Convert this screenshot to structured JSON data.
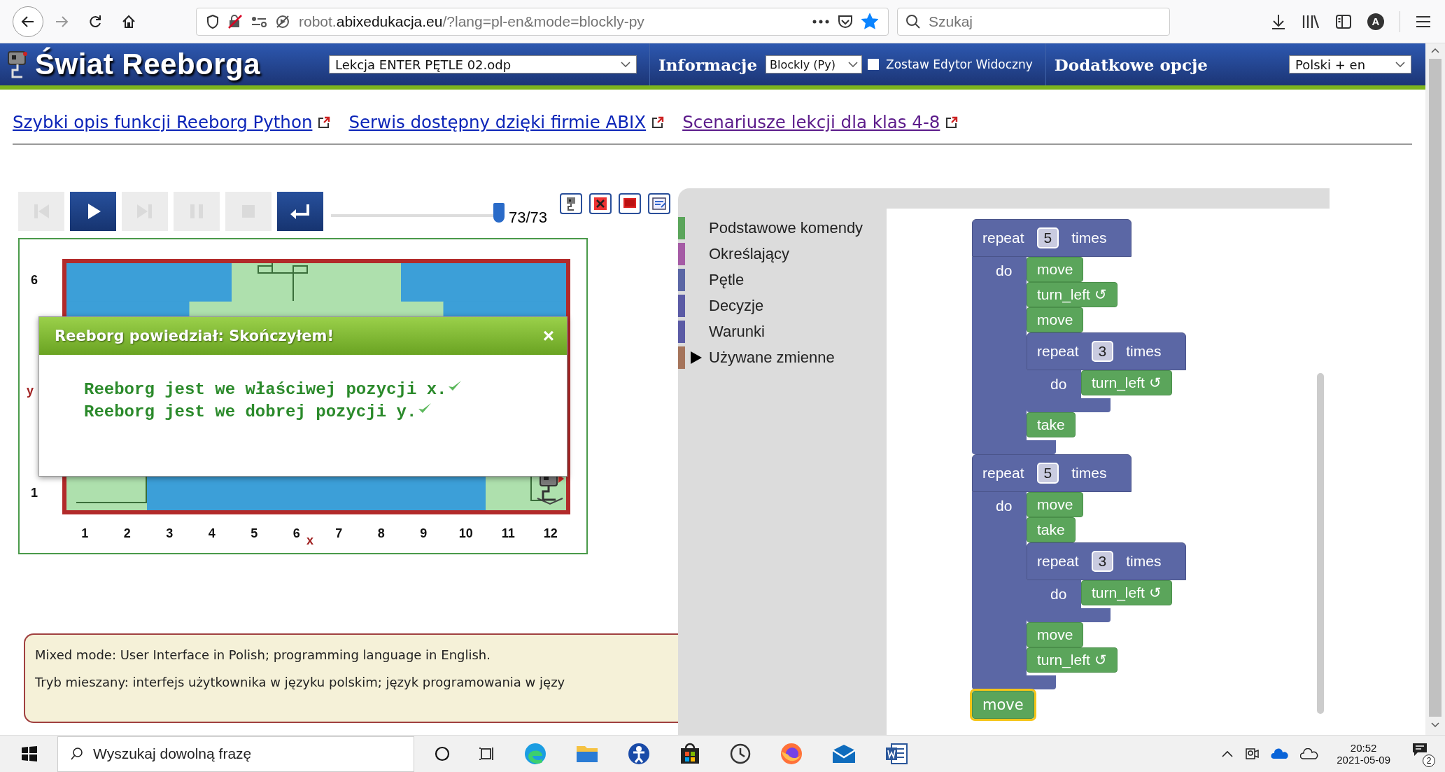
{
  "browser": {
    "nav_buttons": [
      {
        "kind": "back",
        "disabled": false
      },
      {
        "kind": "forward",
        "disabled": true
      },
      {
        "kind": "reload",
        "disabled": false
      },
      {
        "kind": "home",
        "disabled": false
      }
    ],
    "url": {
      "host_prefix": "robot.",
      "domain": "abixedukacja.eu",
      "path": "/?lang=pl-en&mode=blockly-py"
    },
    "bookmarked": true,
    "search": {
      "placeholder": "Szukaj"
    },
    "account_initial": "A"
  },
  "site_header": {
    "title": "Świat Reeborga",
    "lesson_select": "Lekcja ENTER PĘTLE 02.odp",
    "info_menu": "Informacje",
    "mode_select": "Blockly (Py)",
    "keep_editor": {
      "label": "Zostaw Edytor Widoczny",
      "checked": false
    },
    "more_options": "Dodatkowe opcje",
    "language_select": "Polski + en"
  },
  "links": [
    {
      "text": "Szybki opis funkcji Reeborg Python",
      "visited": false
    },
    {
      "text": "Serwis dostępny dzięki firmie ABIX",
      "visited": false
    },
    {
      "text": "Scenariusze lekcji dla klas 4-8",
      "visited": true
    }
  ],
  "controls": {
    "buttons": [
      {
        "kind": "first",
        "disabled": true
      },
      {
        "kind": "play",
        "disabled": false
      },
      {
        "kind": "step",
        "disabled": true
      },
      {
        "kind": "pause",
        "disabled": true
      },
      {
        "kind": "stop",
        "disabled": true
      },
      {
        "kind": "return",
        "disabled": false
      }
    ],
    "slider": {
      "level": 1
    },
    "step_counter": "73/73",
    "tools": [
      {
        "kind": "robot"
      },
      {
        "kind": "remove"
      },
      {
        "kind": "flag"
      },
      {
        "kind": "edit"
      }
    ]
  },
  "world": {
    "y_axis_label": "y",
    "x_axis_label": "x",
    "y_labels": [
      "6",
      "1"
    ],
    "x_labels": [
      "1",
      "2",
      "3",
      "4",
      "5",
      "6",
      "7",
      "8",
      "9",
      "10",
      "11",
      "12"
    ]
  },
  "message": {
    "title": "Reeborg powiedział: Skończyłem!",
    "close": "×",
    "lines": [
      {
        "text": "Reeborg jest we właściwej pozycji x.",
        "passed": true
      },
      {
        "text": "Reeborg jest we dobrej pozycji y.",
        "passed": true
      }
    ]
  },
  "info": {
    "lines": [
      "Mixed mode: User Interface in Polish; programming language in English.",
      "Tryb mieszany: interfejs użytkownika w języku polskim; język programowania w języ"
    ]
  },
  "blockly": {
    "categories": [
      {
        "name": "Podstawowe komendy",
        "color": "#5ba55b",
        "has_children": false
      },
      {
        "name": "Określający",
        "color": "#a55ba5",
        "has_children": false
      },
      {
        "name": "Pętle",
        "color": "#5b67a5",
        "has_children": false
      },
      {
        "name": "Decyzje",
        "color": "#5b5ba5",
        "has_children": false
      },
      {
        "name": "Warunki",
        "color": "#5b5ba5",
        "has_children": false
      },
      {
        "name": "Używane zmienne",
        "color": "#a5745b",
        "has_children": true
      }
    ],
    "program": [
      {
        "kind": "repeat",
        "keyword": "repeat",
        "count": "5",
        "suffix": "times",
        "do_label": "do",
        "body": [
          {
            "kind": "command",
            "label": "move",
            "selected": false
          },
          {
            "kind": "command",
            "label": "turn_left ↺",
            "selected": false
          },
          {
            "kind": "command",
            "label": "move",
            "selected": false
          },
          {
            "kind": "repeat",
            "keyword": "repeat",
            "count": "3",
            "suffix": "times",
            "do_label": "do",
            "body": [
              {
                "kind": "command",
                "label": "turn_left ↺",
                "selected": false
              }
            ]
          },
          {
            "kind": "command",
            "label": "take",
            "selected": false
          }
        ]
      },
      {
        "kind": "repeat",
        "keyword": "repeat",
        "count": "5",
        "suffix": "times",
        "do_label": "do",
        "body": [
          {
            "kind": "command",
            "label": "move",
            "selected": false
          },
          {
            "kind": "command",
            "label": "take",
            "selected": false
          },
          {
            "kind": "repeat",
            "keyword": "repeat",
            "count": "3",
            "suffix": "times",
            "do_label": "do",
            "body": [
              {
                "kind": "command",
                "label": "turn_left ↺",
                "selected": false
              }
            ]
          },
          {
            "kind": "command",
            "label": "move",
            "selected": false
          },
          {
            "kind": "command",
            "label": "turn_left ↺",
            "selected": false
          }
        ]
      },
      {
        "kind": "command",
        "label": "move",
        "selected": true
      }
    ]
  },
  "taskbar": {
    "search_placeholder": "Wyszukaj dowolną frazę",
    "apps": [
      {
        "kind": "cortana"
      },
      {
        "kind": "task-view"
      },
      {
        "kind": "edge"
      },
      {
        "kind": "explorer"
      },
      {
        "kind": "accessibility"
      },
      {
        "kind": "store"
      },
      {
        "kind": "clock"
      },
      {
        "kind": "firefox"
      },
      {
        "kind": "mail"
      },
      {
        "kind": "word"
      }
    ],
    "time": "20:52",
    "date": "2021-05-09",
    "notifications": "2"
  }
}
